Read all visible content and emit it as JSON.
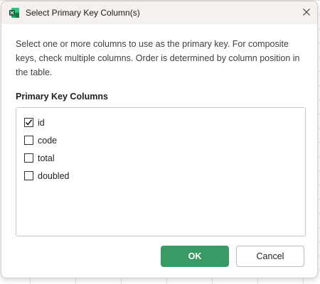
{
  "dialog": {
    "title": "Select Primary Key Column(s)",
    "app_icon": "excel-icon",
    "close_icon": "close-icon",
    "description": "Select one or more columns to use as the primary key. For composite keys, check multiple columns. Order is determined by column position in the table.",
    "section_label": "Primary Key Columns",
    "columns": [
      {
        "label": "id",
        "checked": true
      },
      {
        "label": "code",
        "checked": false
      },
      {
        "label": "total",
        "checked": false
      },
      {
        "label": "doubled",
        "checked": false
      }
    ],
    "ok_label": "OK",
    "cancel_label": "Cancel"
  },
  "colors": {
    "ok_button": "#3a9a66",
    "titlebar": "#f6f0ee",
    "excel_green": "#1e7145"
  }
}
